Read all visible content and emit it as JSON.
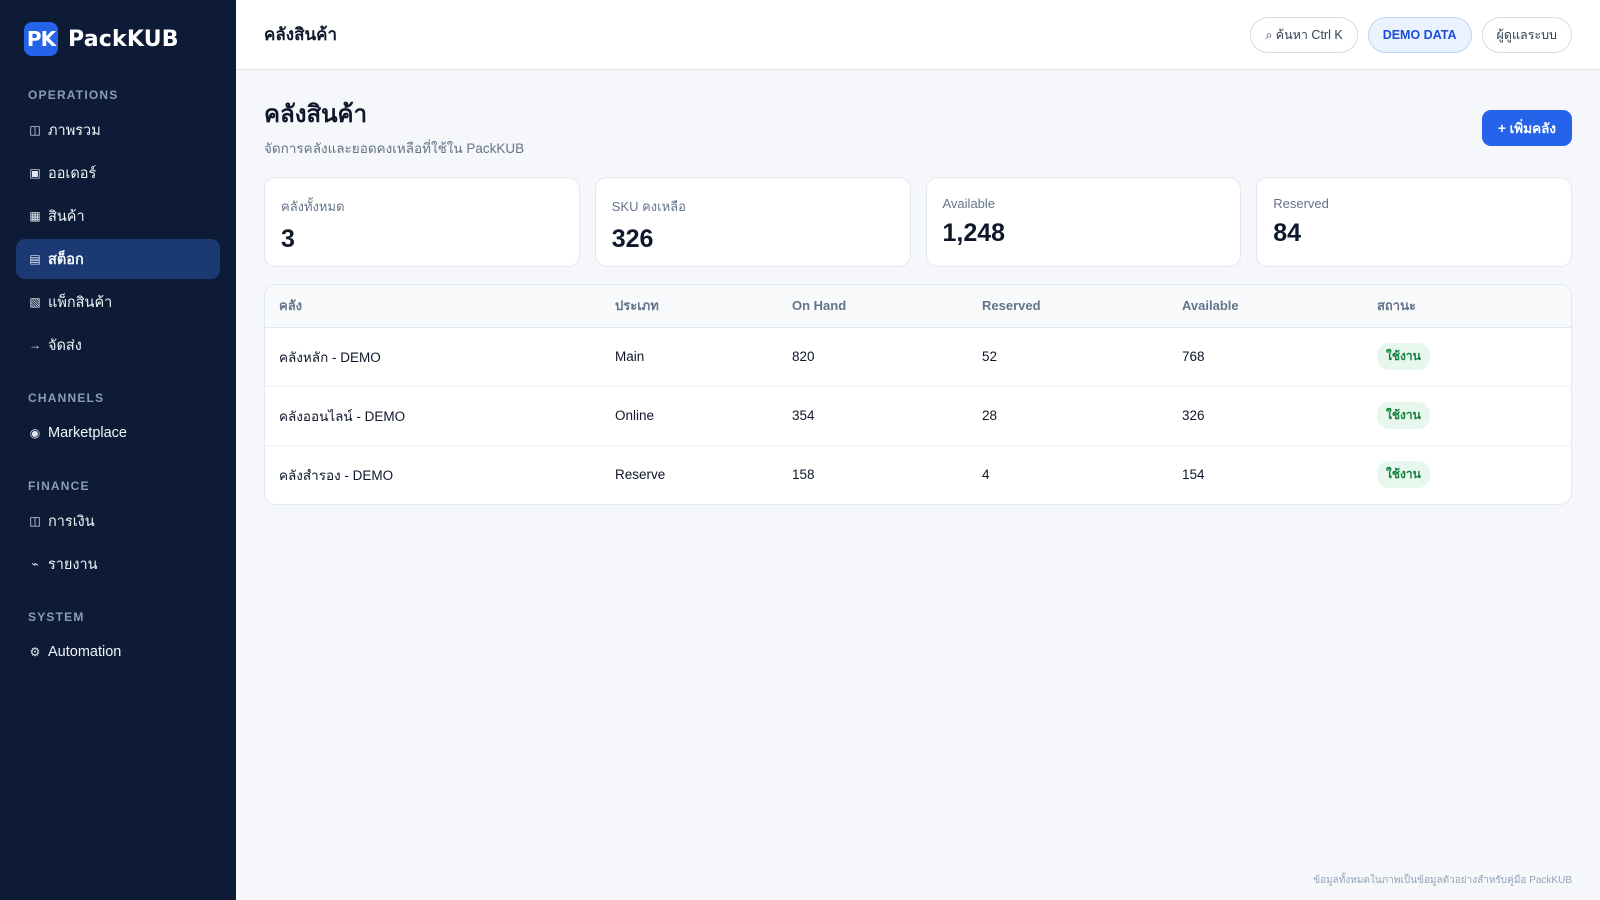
{
  "brand": {
    "logo": "PK",
    "name": "PackKUB"
  },
  "sidebar": {
    "sections": [
      {
        "title": "OPERATIONS",
        "items": [
          {
            "icon": "◫",
            "label": "ภาพรวม"
          },
          {
            "icon": "▣",
            "label": "ออเดอร์"
          },
          {
            "icon": "▦",
            "label": "สินค้า"
          },
          {
            "icon": "▤",
            "label": "สต็อก"
          },
          {
            "icon": "▧",
            "label": "แพ็กสินค้า"
          },
          {
            "icon": "→",
            "label": "จัดส่ง"
          }
        ]
      },
      {
        "title": "CHANNELS",
        "items": [
          {
            "icon": "◉",
            "label": "Marketplace"
          }
        ]
      },
      {
        "title": "FINANCE",
        "items": [
          {
            "icon": "◫",
            "label": "การเงิน"
          },
          {
            "icon": "⌁",
            "label": "รายงาน"
          }
        ]
      },
      {
        "title": "SYSTEM",
        "items": [
          {
            "icon": "⚙",
            "label": "Automation"
          }
        ]
      }
    ],
    "active_item": "สต็อก"
  },
  "topbar": {
    "title": "คลังสินค้า",
    "search_label": "⌕ ค้นหา Ctrl K",
    "demo_label": "DEMO DATA",
    "user_label": "ผู้ดูแลระบบ"
  },
  "page": {
    "title": "คลังสินค้า",
    "subtitle": "จัดการคลังและยอดคงเหลือที่ใช้ใน PackKUB",
    "add_button": "+ เพิ่มคลัง"
  },
  "stats": [
    {
      "label": "คลังทั้งหมด",
      "value": "3"
    },
    {
      "label": "SKU คงเหลือ",
      "value": "326"
    },
    {
      "label": "Available",
      "value": "1,248"
    },
    {
      "label": "Reserved",
      "value": "84"
    }
  ],
  "table": {
    "headers": [
      "คลัง",
      "ประเภท",
      "On Hand",
      "Reserved",
      "Available",
      "สถานะ"
    ],
    "rows": [
      {
        "name": "คลังหลัก - DEMO",
        "type": "Main",
        "on_hand": "820",
        "reserved": "52",
        "available": "768",
        "status": "ใช้งาน"
      },
      {
        "name": "คลังออนไลน์ - DEMO",
        "type": "Online",
        "on_hand": "354",
        "reserved": "28",
        "available": "326",
        "status": "ใช้งาน"
      },
      {
        "name": "คลังสำรอง - DEMO",
        "type": "Reserve",
        "on_hand": "158",
        "reserved": "4",
        "available": "154",
        "status": "ใช้งาน"
      }
    ]
  },
  "footer_note": "ข้อมูลทั้งหมดในภาพเป็นข้อมูลตัวอย่างสำหรับคู่มือ PackKUB",
  "colors": {
    "sidebar_bg": "#0d1b36",
    "accent": "#2563eb",
    "active_nav": "#1b3a73",
    "status_green": "#15803d"
  }
}
